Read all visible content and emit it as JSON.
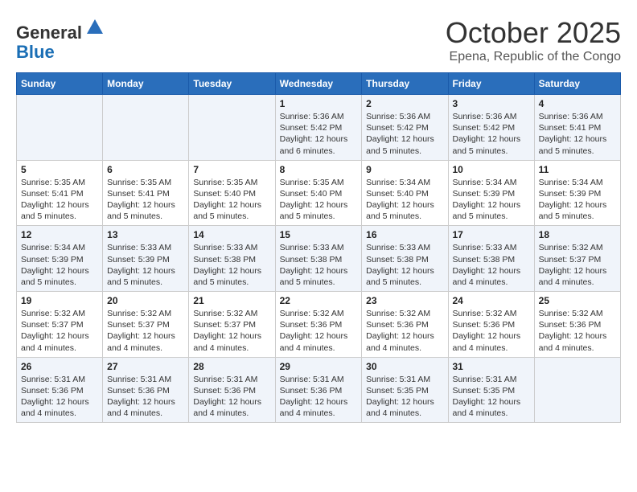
{
  "header": {
    "logo_line1": "General",
    "logo_line2": "Blue",
    "month": "October 2025",
    "location": "Epena, Republic of the Congo"
  },
  "days_of_week": [
    "Sunday",
    "Monday",
    "Tuesday",
    "Wednesday",
    "Thursday",
    "Friday",
    "Saturday"
  ],
  "weeks": [
    [
      {
        "day": "",
        "info": ""
      },
      {
        "day": "",
        "info": ""
      },
      {
        "day": "",
        "info": ""
      },
      {
        "day": "1",
        "info": "Sunrise: 5:36 AM\nSunset: 5:42 PM\nDaylight: 12 hours and 6 minutes."
      },
      {
        "day": "2",
        "info": "Sunrise: 5:36 AM\nSunset: 5:42 PM\nDaylight: 12 hours and 5 minutes."
      },
      {
        "day": "3",
        "info": "Sunrise: 5:36 AM\nSunset: 5:42 PM\nDaylight: 12 hours and 5 minutes."
      },
      {
        "day": "4",
        "info": "Sunrise: 5:36 AM\nSunset: 5:41 PM\nDaylight: 12 hours and 5 minutes."
      }
    ],
    [
      {
        "day": "5",
        "info": "Sunrise: 5:35 AM\nSunset: 5:41 PM\nDaylight: 12 hours and 5 minutes."
      },
      {
        "day": "6",
        "info": "Sunrise: 5:35 AM\nSunset: 5:41 PM\nDaylight: 12 hours and 5 minutes."
      },
      {
        "day": "7",
        "info": "Sunrise: 5:35 AM\nSunset: 5:40 PM\nDaylight: 12 hours and 5 minutes."
      },
      {
        "day": "8",
        "info": "Sunrise: 5:35 AM\nSunset: 5:40 PM\nDaylight: 12 hours and 5 minutes."
      },
      {
        "day": "9",
        "info": "Sunrise: 5:34 AM\nSunset: 5:40 PM\nDaylight: 12 hours and 5 minutes."
      },
      {
        "day": "10",
        "info": "Sunrise: 5:34 AM\nSunset: 5:39 PM\nDaylight: 12 hours and 5 minutes."
      },
      {
        "day": "11",
        "info": "Sunrise: 5:34 AM\nSunset: 5:39 PM\nDaylight: 12 hours and 5 minutes."
      }
    ],
    [
      {
        "day": "12",
        "info": "Sunrise: 5:34 AM\nSunset: 5:39 PM\nDaylight: 12 hours and 5 minutes."
      },
      {
        "day": "13",
        "info": "Sunrise: 5:33 AM\nSunset: 5:39 PM\nDaylight: 12 hours and 5 minutes."
      },
      {
        "day": "14",
        "info": "Sunrise: 5:33 AM\nSunset: 5:38 PM\nDaylight: 12 hours and 5 minutes."
      },
      {
        "day": "15",
        "info": "Sunrise: 5:33 AM\nSunset: 5:38 PM\nDaylight: 12 hours and 5 minutes."
      },
      {
        "day": "16",
        "info": "Sunrise: 5:33 AM\nSunset: 5:38 PM\nDaylight: 12 hours and 5 minutes."
      },
      {
        "day": "17",
        "info": "Sunrise: 5:33 AM\nSunset: 5:38 PM\nDaylight: 12 hours and 4 minutes."
      },
      {
        "day": "18",
        "info": "Sunrise: 5:32 AM\nSunset: 5:37 PM\nDaylight: 12 hours and 4 minutes."
      }
    ],
    [
      {
        "day": "19",
        "info": "Sunrise: 5:32 AM\nSunset: 5:37 PM\nDaylight: 12 hours and 4 minutes."
      },
      {
        "day": "20",
        "info": "Sunrise: 5:32 AM\nSunset: 5:37 PM\nDaylight: 12 hours and 4 minutes."
      },
      {
        "day": "21",
        "info": "Sunrise: 5:32 AM\nSunset: 5:37 PM\nDaylight: 12 hours and 4 minutes."
      },
      {
        "day": "22",
        "info": "Sunrise: 5:32 AM\nSunset: 5:36 PM\nDaylight: 12 hours and 4 minutes."
      },
      {
        "day": "23",
        "info": "Sunrise: 5:32 AM\nSunset: 5:36 PM\nDaylight: 12 hours and 4 minutes."
      },
      {
        "day": "24",
        "info": "Sunrise: 5:32 AM\nSunset: 5:36 PM\nDaylight: 12 hours and 4 minutes."
      },
      {
        "day": "25",
        "info": "Sunrise: 5:32 AM\nSunset: 5:36 PM\nDaylight: 12 hours and 4 minutes."
      }
    ],
    [
      {
        "day": "26",
        "info": "Sunrise: 5:31 AM\nSunset: 5:36 PM\nDaylight: 12 hours and 4 minutes."
      },
      {
        "day": "27",
        "info": "Sunrise: 5:31 AM\nSunset: 5:36 PM\nDaylight: 12 hours and 4 minutes."
      },
      {
        "day": "28",
        "info": "Sunrise: 5:31 AM\nSunset: 5:36 PM\nDaylight: 12 hours and 4 minutes."
      },
      {
        "day": "29",
        "info": "Sunrise: 5:31 AM\nSunset: 5:36 PM\nDaylight: 12 hours and 4 minutes."
      },
      {
        "day": "30",
        "info": "Sunrise: 5:31 AM\nSunset: 5:35 PM\nDaylight: 12 hours and 4 minutes."
      },
      {
        "day": "31",
        "info": "Sunrise: 5:31 AM\nSunset: 5:35 PM\nDaylight: 12 hours and 4 minutes."
      },
      {
        "day": "",
        "info": ""
      }
    ]
  ]
}
